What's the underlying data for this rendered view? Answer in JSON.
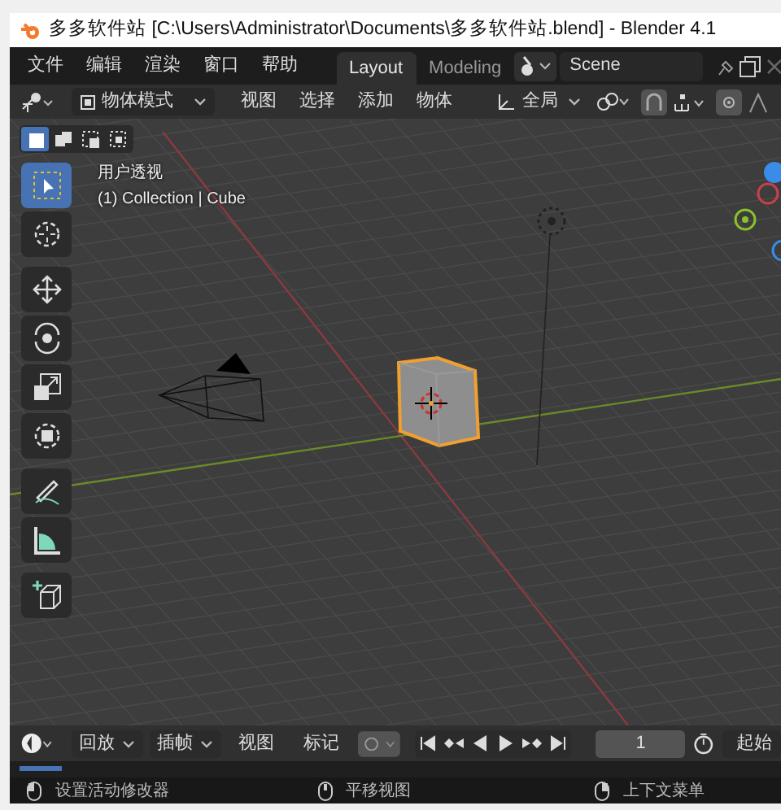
{
  "window": {
    "title": "多多软件站 [C:\\Users\\Administrator\\Documents\\多多软件站.blend] - Blender 4.1"
  },
  "topbar": {
    "menus": [
      "文件",
      "编辑",
      "渲染",
      "窗口",
      "帮助"
    ],
    "workspaces": [
      {
        "label": "Layout",
        "selected": true
      },
      {
        "label": "Modeling",
        "selected": false
      }
    ],
    "scene": "Scene"
  },
  "header": {
    "mode": "物体模式",
    "menus": [
      "视图",
      "选择",
      "添加",
      "物体"
    ],
    "orientation": "全局"
  },
  "select_modes": [
    {
      "kind": "new",
      "selected": true
    },
    {
      "kind": "extend",
      "selected": false
    },
    {
      "kind": "subtract",
      "selected": false
    },
    {
      "kind": "intersect",
      "selected": false
    }
  ],
  "viewport": {
    "view_name": "用户透视",
    "object_info": "(1) Collection | Cube"
  },
  "toolbar": [
    {
      "tools": [
        {
          "kind": "select_box",
          "selected": true
        },
        {
          "kind": "cursor",
          "selected": false
        }
      ]
    },
    {
      "tools": [
        {
          "kind": "move",
          "selected": false
        },
        {
          "kind": "rotate",
          "selected": false
        },
        {
          "kind": "scale",
          "selected": false
        },
        {
          "kind": "transform",
          "selected": false
        }
      ]
    },
    {
      "tools": [
        {
          "kind": "annotate",
          "selected": false
        },
        {
          "kind": "measure",
          "selected": false
        }
      ]
    },
    {
      "tools": [
        {
          "kind": "add_cube",
          "selected": false
        }
      ]
    }
  ],
  "timeline": {
    "menus": [
      {
        "label": "回放",
        "dropdown": true
      },
      {
        "label": "插帧",
        "dropdown": true
      },
      {
        "label": "视图",
        "dropdown": false
      },
      {
        "label": "标记",
        "dropdown": false
      }
    ],
    "current_frame": "1",
    "start_label": "起始"
  },
  "status_bar": [
    "设置活动修改器",
    "平移视图",
    "上下文菜单"
  ]
}
